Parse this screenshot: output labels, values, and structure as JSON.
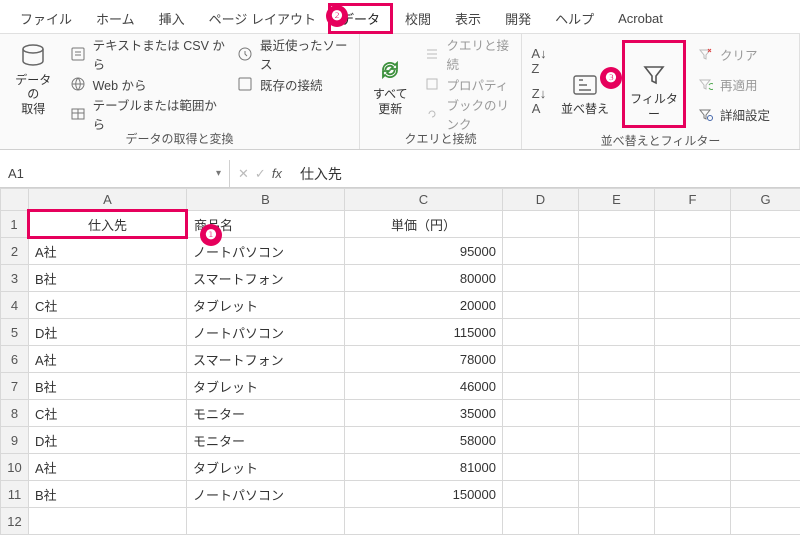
{
  "tabs": {
    "file": "ファイル",
    "home": "ホーム",
    "insert": "挿入",
    "pagelayout": "ページ レイアウト",
    "data": "データ",
    "review": "校閲",
    "view": "表示",
    "developer": "開発",
    "help": "ヘルプ",
    "acrobat": "Acrobat"
  },
  "ribbon": {
    "group1_label": "データの取得と変換",
    "group2_label": "クエリと接続",
    "group3_label": "並べ替えとフィルター",
    "get_data": "データの\n取得",
    "from_csv": "テキストまたは CSV から",
    "from_web": "Web から",
    "from_table": "テーブルまたは範囲から",
    "recent": "最近使ったソース",
    "existing": "既存の接続",
    "refresh": "すべて\n更新",
    "queries": "クエリと接続",
    "properties": "プロパティ",
    "booklinks": "ブックのリンク",
    "sort": "並べ替え",
    "filter": "フィルター",
    "clear": "クリア",
    "reapply": "再適用",
    "advanced": "詳細設定",
    "az": "A↓Z",
    "za": "Z↓A"
  },
  "name_box": "A1",
  "formula_value": "仕入先",
  "columns": [
    "A",
    "B",
    "C",
    "D",
    "E",
    "F",
    "G"
  ],
  "headers": {
    "A": "仕入先",
    "B": "商品名",
    "C": "単価（円）"
  },
  "rows": [
    {
      "A": "A社",
      "B": "ノートパソコン",
      "C": "95000"
    },
    {
      "A": "B社",
      "B": "スマートフォン",
      "C": "80000"
    },
    {
      "A": "C社",
      "B": "タブレット",
      "C": "20000"
    },
    {
      "A": "D社",
      "B": "ノートパソコン",
      "C": "115000"
    },
    {
      "A": "A社",
      "B": "スマートフォン",
      "C": "78000"
    },
    {
      "A": "B社",
      "B": "タブレット",
      "C": "46000"
    },
    {
      "A": "C社",
      "B": "モニター",
      "C": "35000"
    },
    {
      "A": "D社",
      "B": "モニター",
      "C": "58000"
    },
    {
      "A": "A社",
      "B": "タブレット",
      "C": "81000"
    },
    {
      "A": "B社",
      "B": "ノートパソコン",
      "C": "150000"
    }
  ],
  "callouts": {
    "c1": "❶",
    "c2": "❷",
    "c3": "❸"
  }
}
